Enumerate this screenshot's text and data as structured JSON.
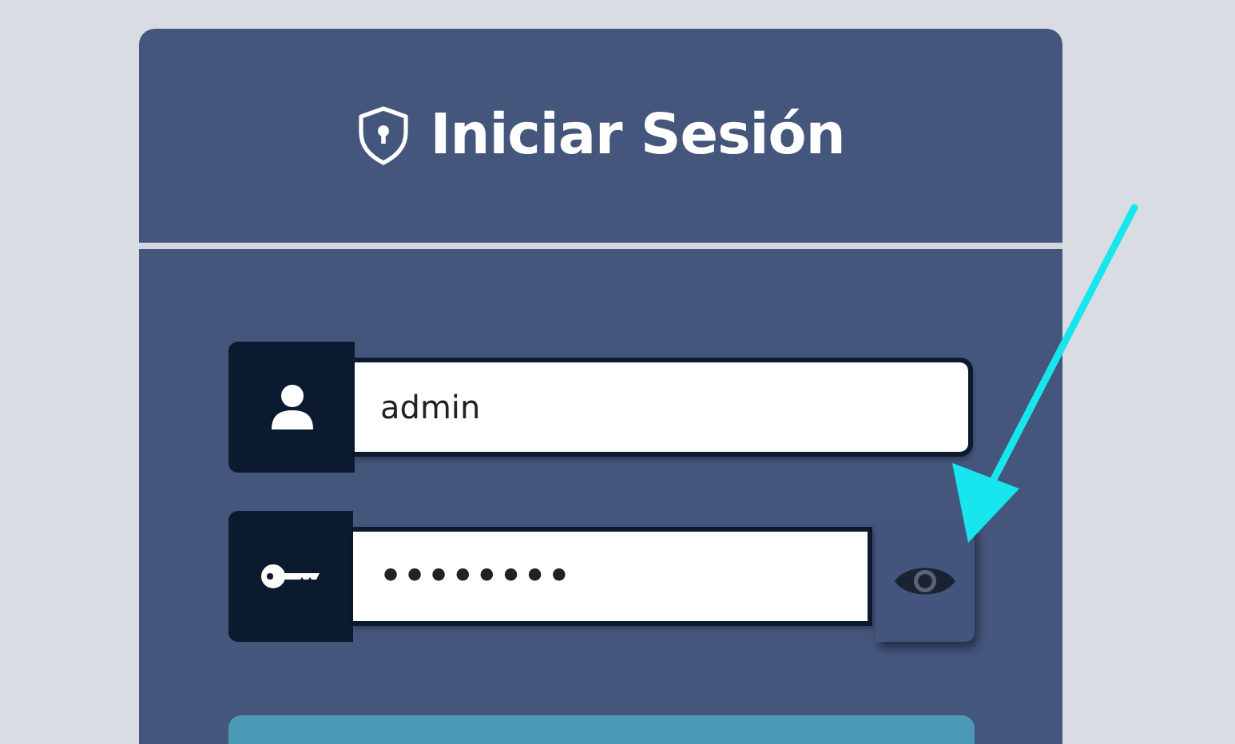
{
  "login": {
    "title": "Iniciar Sesión",
    "username": {
      "value": "admin"
    },
    "password": {
      "value": "••••••••",
      "reveal_hovered": true
    }
  }
}
